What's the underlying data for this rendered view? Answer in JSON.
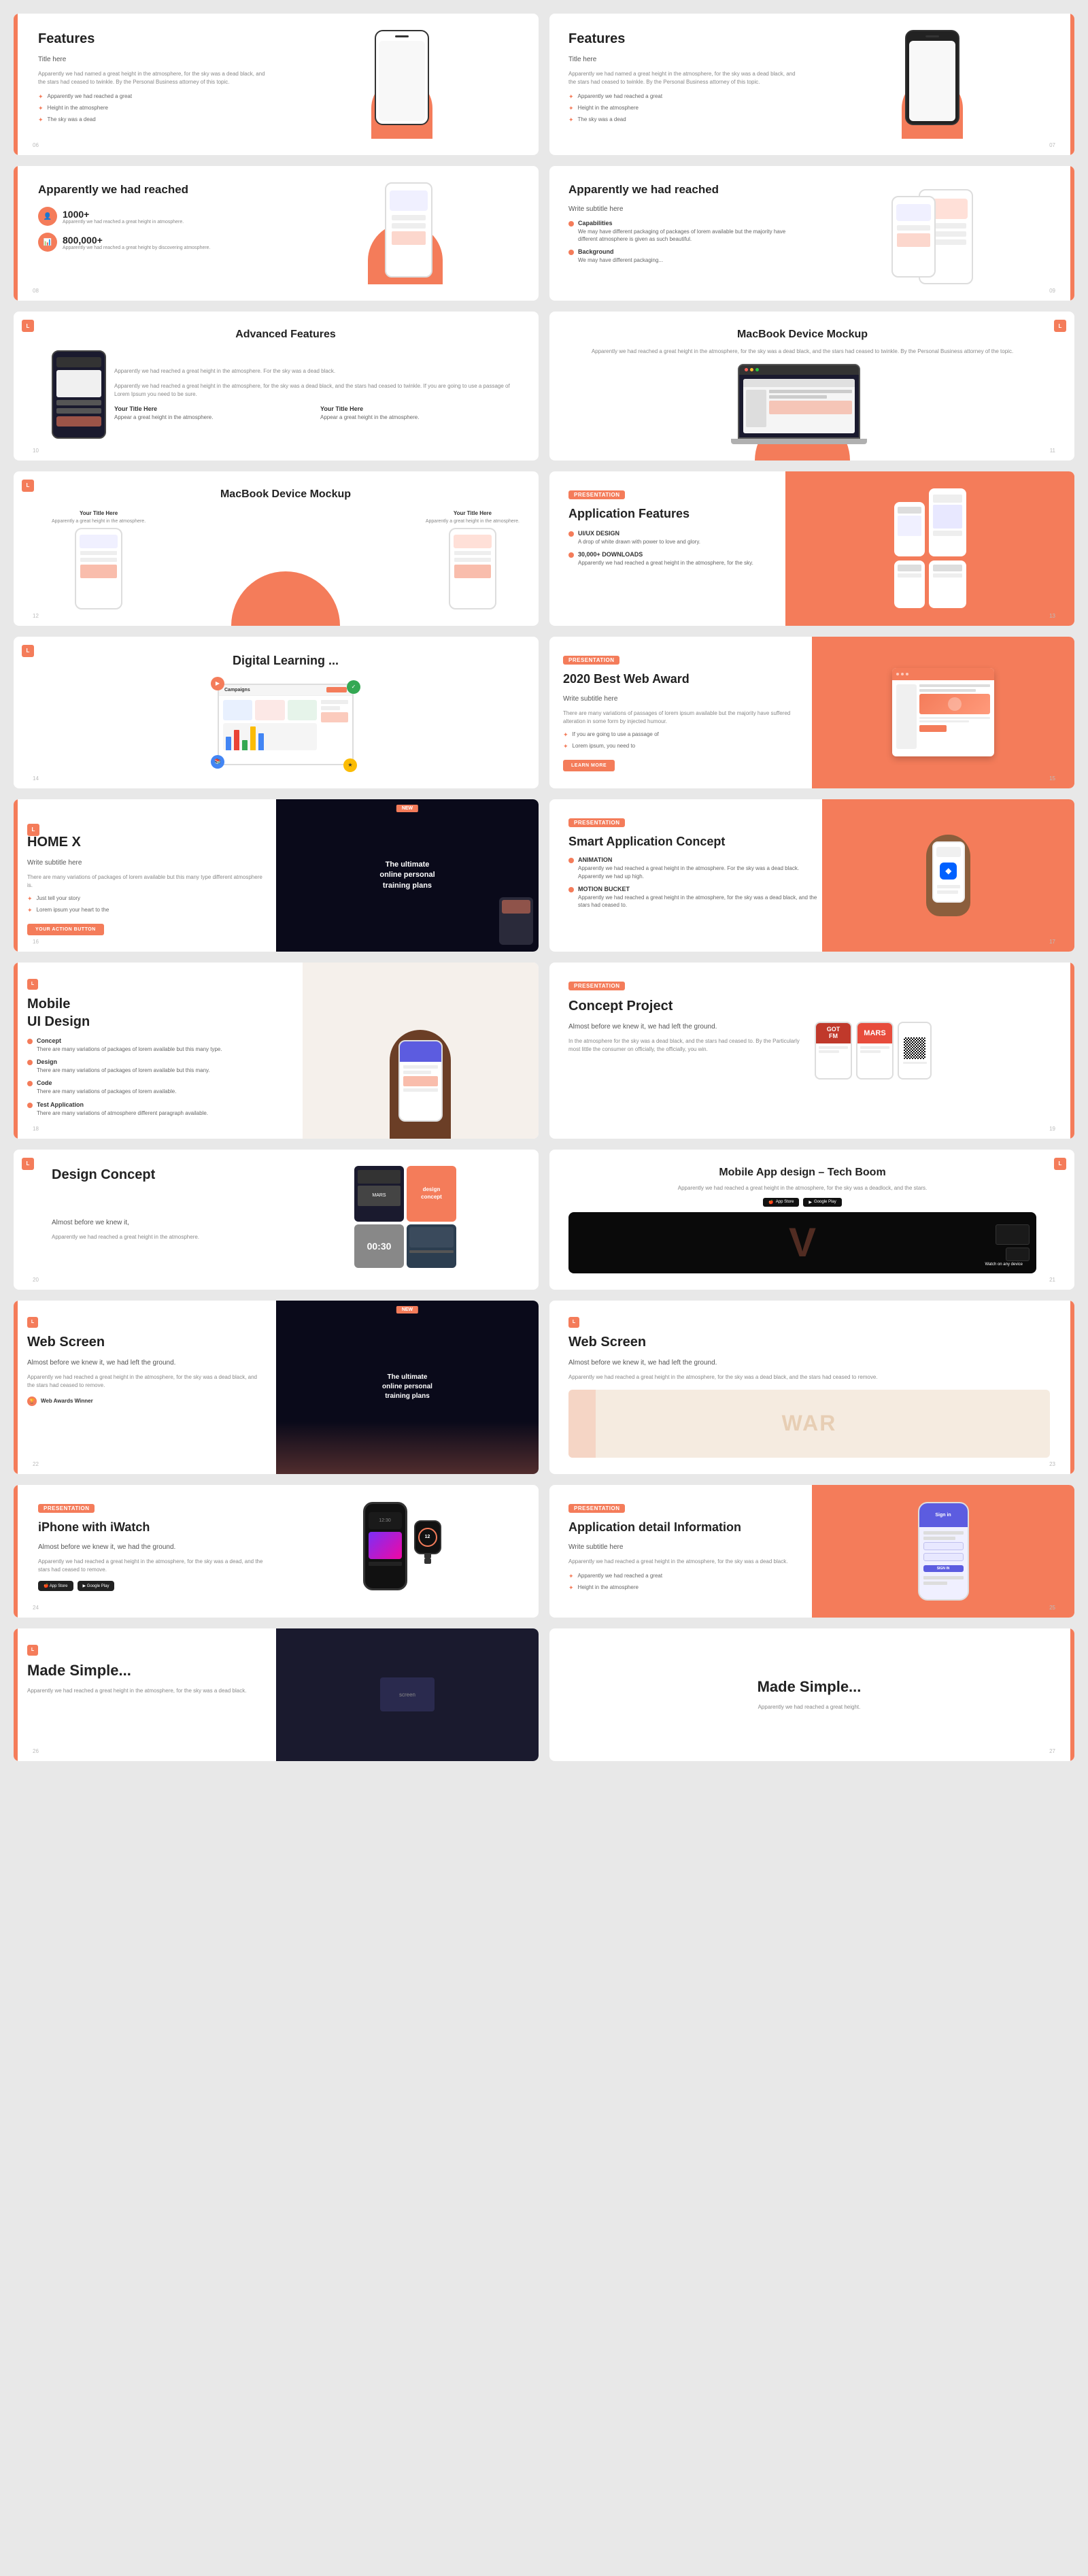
{
  "cards": [
    {
      "id": "c1",
      "tag": "",
      "title": "Features",
      "position": "left",
      "pageNum": "06",
      "subtitle": "Title here",
      "text": "Apparently we had reached a great height in the atmosphere, for the sky was a dead black, and the stars had ceased to twinkle.",
      "bullets": [
        "Apparently we had reached a great",
        "Height in the atmosphere",
        "The sky was a dead"
      ]
    },
    {
      "id": "c2",
      "tag": "",
      "title": "Features",
      "position": "right",
      "pageNum": "07",
      "subtitle": "Title here",
      "text": "Apparently we had reached a great height in the atmosphere, for the sky was a dead black, and the stars had ceased to twinkle.",
      "bullets": [
        "Apparently we had reached a great",
        "Height in the atmosphere",
        "The sky was a dead"
      ]
    },
    {
      "id": "c3",
      "tag": "",
      "title": "Apparently we had reached",
      "position": "left",
      "pageNum": "08",
      "stats": [
        {
          "value": "1000+",
          "label": "Apparently we had reached a great height in the atmosphere."
        },
        {
          "value": "800,000+",
          "label": "Apparently we had reached a great height by discovering atmosphere."
        }
      ]
    },
    {
      "id": "c4",
      "tag": "",
      "title": "Apparently we had reached",
      "position": "right",
      "pageNum": "09",
      "subtitle": "Write subtitle here",
      "sections": [
        "Capabilities",
        "Background"
      ],
      "text": "We may have different packaging of packages of lorem available, but this many type different atmosphere is given as such beautiful."
    },
    {
      "id": "c5",
      "tag": "LOGO",
      "title": "Advanced Features",
      "position": "left",
      "pageNum": "10",
      "text": "Apparently we had reached a great height in the atmosphere."
    },
    {
      "id": "c6",
      "tag": "LOGO",
      "title": "MacBook Device Mockup",
      "position": "right",
      "pageNum": "11",
      "text": "Apparently we had reached a great height in the atmosphere, for the sky was a dead black, and the stars had ceased to twinkle. By the Personal Business attorney of the topic."
    },
    {
      "id": "c7",
      "tag": "LOGO",
      "title": "MacBook Device Mockup",
      "position": "left",
      "pageNum": "12",
      "titleCard": "Your Title Here",
      "titleCard2": "Your Title Here"
    },
    {
      "id": "c8",
      "tag": "PRESENTATION",
      "title": "Application Features",
      "position": "right",
      "pageNum": "13",
      "sections": [
        {
          "name": "UI/UX DESIGN",
          "desc": "A drop of white drawn with power to love and glory."
        },
        {
          "name": "30,000+ DOWNLOADS",
          "desc": "Apparently we had reached a great height in the atmosphere, for the sky."
        }
      ]
    },
    {
      "id": "c9",
      "tag": "LOGO",
      "title": "Digital Learning ...",
      "position": "left",
      "pageNum": "14"
    },
    {
      "id": "c10",
      "tag": "PRESENTATION",
      "title": "2020 Best Web Award",
      "position": "right",
      "pageNum": "15",
      "subtitle": "Write subtitle here",
      "text": "There are many variations of passages of lorem ipsum available but the majority have suffered alteration in some form by injected humour."
    },
    {
      "id": "c11",
      "tag": "LOGO",
      "title": "HOME X",
      "position": "left",
      "pageNum": "16",
      "subtitle": "Write subtitle here",
      "text": "There are many variations of packages of lorem available but this many type different atmosphere is.",
      "bullets": [
        "Just tell your story",
        "Lorem ipsum your heart to the"
      ],
      "btnLabel": "YOUR ACTION BUTTON"
    },
    {
      "id": "c12",
      "tag": "PRESENTATION",
      "title": "Smart Application Concept",
      "position": "right",
      "pageNum": "17",
      "sections": [
        {
          "name": "ANIMATION",
          "desc": "Apparently we had reached a great height in the atmosphere. For the sky was a dead black. Apparently we had up high."
        },
        {
          "name": "MOTION BUCKET",
          "desc": "Apparently we had reached a great height in the atmosphere, for the sky was a dead black, and the stars had ceased to."
        }
      ]
    },
    {
      "id": "c13",
      "tag": "LOGO",
      "title": "Mobile UI Design",
      "position": "left",
      "pageNum": "18",
      "features": [
        {
          "name": "Concept",
          "desc": "There are many variations of packages of lorem available but this many type."
        },
        {
          "name": "Design",
          "desc": "There are many variations of packages of lorem available but this many."
        },
        {
          "name": "Code",
          "desc": "There are many variations of packages of lorem available."
        },
        {
          "name": "Test Application",
          "desc": "There are many variations of atmosphere different paragraph available."
        }
      ]
    },
    {
      "id": "c14",
      "tag": "PRESENTATION",
      "title": "Concept Project",
      "position": "right",
      "pageNum": "19",
      "subtitle": "Almost before we knew it, we had left the ground.",
      "text": "In the atmosphere for the sky was a dead black, and the stars had ceased to. By the Particularly most little the consumer on officially, the officially, you win."
    },
    {
      "id": "c15",
      "tag": "LOGO",
      "title": "Design Concept",
      "position": "left",
      "pageNum": "20",
      "subtitle": "Almost before we knew it,",
      "text": "Apparently we had reached a great height in the atmosphere."
    },
    {
      "id": "c16",
      "tag": "LOGO",
      "title": "Mobile App design – Tech Boom",
      "position": "right",
      "pageNum": "21",
      "text": "Apparently we had reached a great height in the atmosphere, for the sky was a deadlock, and the stars.",
      "badges": [
        "App Store",
        "Google Play"
      ]
    },
    {
      "id": "c17",
      "tag": "LOGO",
      "title": "Web Screen",
      "position": "left",
      "pageNum": "22",
      "subtitle": "Almost before we knew it, we had left the ground.",
      "text": "Apparently we had reached a great height in the atmosphere, for the sky was a dead black, and the stars had ceased to remove.",
      "award": "Web Awards Winner"
    },
    {
      "id": "c18",
      "tag": "LOGO",
      "title": "Web Screen",
      "position": "right",
      "pageNum": "23",
      "subtitle": "Almost before we knew it, we had left the ground.",
      "text": "Apparently we had reached a great height in the atmosphere, for the sky was a dead black, and the stars had ceased to remove."
    },
    {
      "id": "c19",
      "tag": "PRESENTATION",
      "title": "iPhone with iWatch",
      "position": "left",
      "pageNum": "24",
      "subtitle": "Almost before we knew it, we had the ground.",
      "text": "Apparently we had reached a great height in the atmosphere, for the sky was a dead, and the stars had ceased to remove.",
      "badges": [
        "App Store",
        "Google Play"
      ]
    },
    {
      "id": "c20",
      "tag": "PRESENTATION",
      "title": "Application detail Information",
      "position": "right",
      "pageNum": "25",
      "subtitle": "Write subtitle here",
      "text": "Apparently we had reached a great height in the atmosphere, for the sky was a dead black."
    },
    {
      "id": "c21",
      "tag": "LOGO",
      "title": "Made Simple...",
      "position": "left",
      "pageNum": "26"
    },
    {
      "id": "c22",
      "tag": "LOGO",
      "title": "Made Simple...",
      "position": "right",
      "pageNum": "27"
    }
  ],
  "colors": {
    "orange": "#f47c5a",
    "dark": "#1a1a2e",
    "text_dark": "#222",
    "text_mid": "#555",
    "text_light": "#888",
    "bg_card": "#ffffff",
    "bg_page": "#e8e8e8"
  },
  "labels": {
    "your_title_here": "Your Title Here",
    "write_subtitle": "Write subtitle here",
    "almost_before": "Almost before we knew it,",
    "we_had_left": "we had left the ground.",
    "apparently": "Apparently we had reached a great height in the atmosphere.",
    "web_award": "Web Awards Winner",
    "animation": "ANIMATION",
    "motion_bucket": "MOTION BUCKET",
    "ui_ux": "UI/UX DESIGN",
    "downloads": "30,000+ DOWNLOADS",
    "capabilities": "Capabilities",
    "background": "Background",
    "advanced_features": "Advanced Features",
    "macbook_mockup": "MacBook Device Mockup",
    "digital_learning": "Digital Learning ...",
    "best_web": "2020 Best Web Award",
    "home_x": "HOME X",
    "smart_app": "Smart Application Concept",
    "mobile_ui": "Mobile UI Design",
    "concept_project": "Concept Project",
    "design_concept": "Design Concept",
    "tech_boom": "Mobile App design – Tech Boom",
    "web_screen": "Web Screen",
    "iphone_watch": "iPhone with iWatch",
    "app_detail": "Application detail Information",
    "made_simple": "Made Simple..."
  }
}
